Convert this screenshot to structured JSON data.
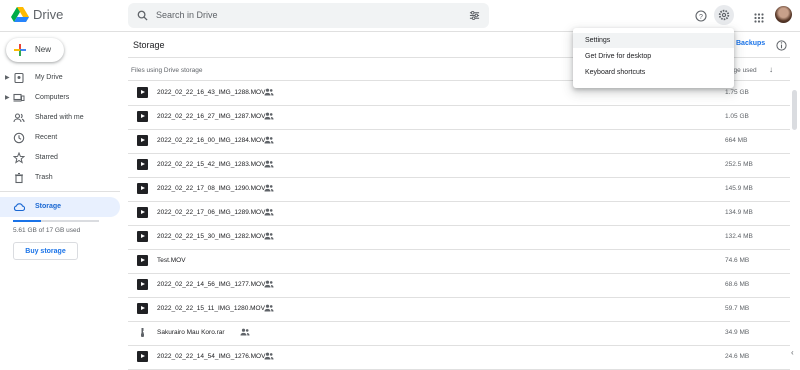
{
  "app": {
    "name": "Drive"
  },
  "search": {
    "placeholder": "Search in Drive"
  },
  "colors": {
    "accent": "#1a73e8",
    "active_bg": "#e8f0fe",
    "storage_bar": "#1a73e8"
  },
  "sidebar": {
    "new_label": "New",
    "items": [
      {
        "label": "My Drive",
        "icon": "my-drive-icon",
        "has_caret": true
      },
      {
        "label": "Computers",
        "icon": "computers-icon",
        "has_caret": true
      },
      {
        "label": "Shared with me",
        "icon": "shared-icon",
        "has_caret": false
      },
      {
        "label": "Recent",
        "icon": "clock-icon",
        "has_caret": false
      },
      {
        "label": "Starred",
        "icon": "star-icon",
        "has_caret": false
      },
      {
        "label": "Trash",
        "icon": "trash-icon",
        "has_caret": false
      },
      {
        "label": "Storage",
        "icon": "cloud-icon",
        "has_caret": false,
        "active": true
      }
    ],
    "storage_used_text": "5.61 GB of 17 GB used",
    "storage_fraction": 0.33,
    "buy_storage": "Buy storage"
  },
  "main": {
    "title": "Storage",
    "backups_link": "Backups",
    "files_header": "Files using Drive storage",
    "col_used": "Storage used"
  },
  "files": [
    {
      "name": "2022_02_22_16_43_IMG_1288.MOV",
      "size": "1.75 GB",
      "shared": true,
      "type": "video"
    },
    {
      "name": "2022_02_22_16_27_IMG_1287.MOV",
      "size": "1.05 GB",
      "shared": true,
      "type": "video"
    },
    {
      "name": "2022_02_22_16_00_IMG_1284.MOV",
      "size": "664 MB",
      "shared": true,
      "type": "video"
    },
    {
      "name": "2022_02_22_15_42_IMG_1283.MOV",
      "size": "252.5 MB",
      "shared": true,
      "type": "video"
    },
    {
      "name": "2022_02_22_17_08_IMG_1290.MOV",
      "size": "145.9 MB",
      "shared": true,
      "type": "video"
    },
    {
      "name": "2022_02_22_17_06_IMG_1289.MOV",
      "size": "134.9 MB",
      "shared": true,
      "type": "video"
    },
    {
      "name": "2022_02_22_15_30_IMG_1282.MOV",
      "size": "132.4 MB",
      "shared": true,
      "type": "video"
    },
    {
      "name": "Test.MOV",
      "size": "74.6 MB",
      "shared": false,
      "type": "video"
    },
    {
      "name": "2022_02_22_14_56_IMG_1277.MOV",
      "size": "68.6 MB",
      "shared": true,
      "type": "video"
    },
    {
      "name": "2022_02_22_15_11_IMG_1280.MOV",
      "size": "59.7 MB",
      "shared": true,
      "type": "video"
    },
    {
      "name": "Sakurairo Mau Koro.rar",
      "size": "34.9 MB",
      "shared": true,
      "type": "archive"
    },
    {
      "name": "2022_02_22_14_54_IMG_1276.MOV",
      "size": "24.6 MB",
      "shared": true,
      "type": "video"
    }
  ],
  "settings_menu": {
    "items": [
      {
        "label": "Settings",
        "highlighted": true
      },
      {
        "label": "Get Drive for desktop",
        "highlighted": false
      },
      {
        "label": "Keyboard shortcuts",
        "highlighted": false
      }
    ]
  }
}
